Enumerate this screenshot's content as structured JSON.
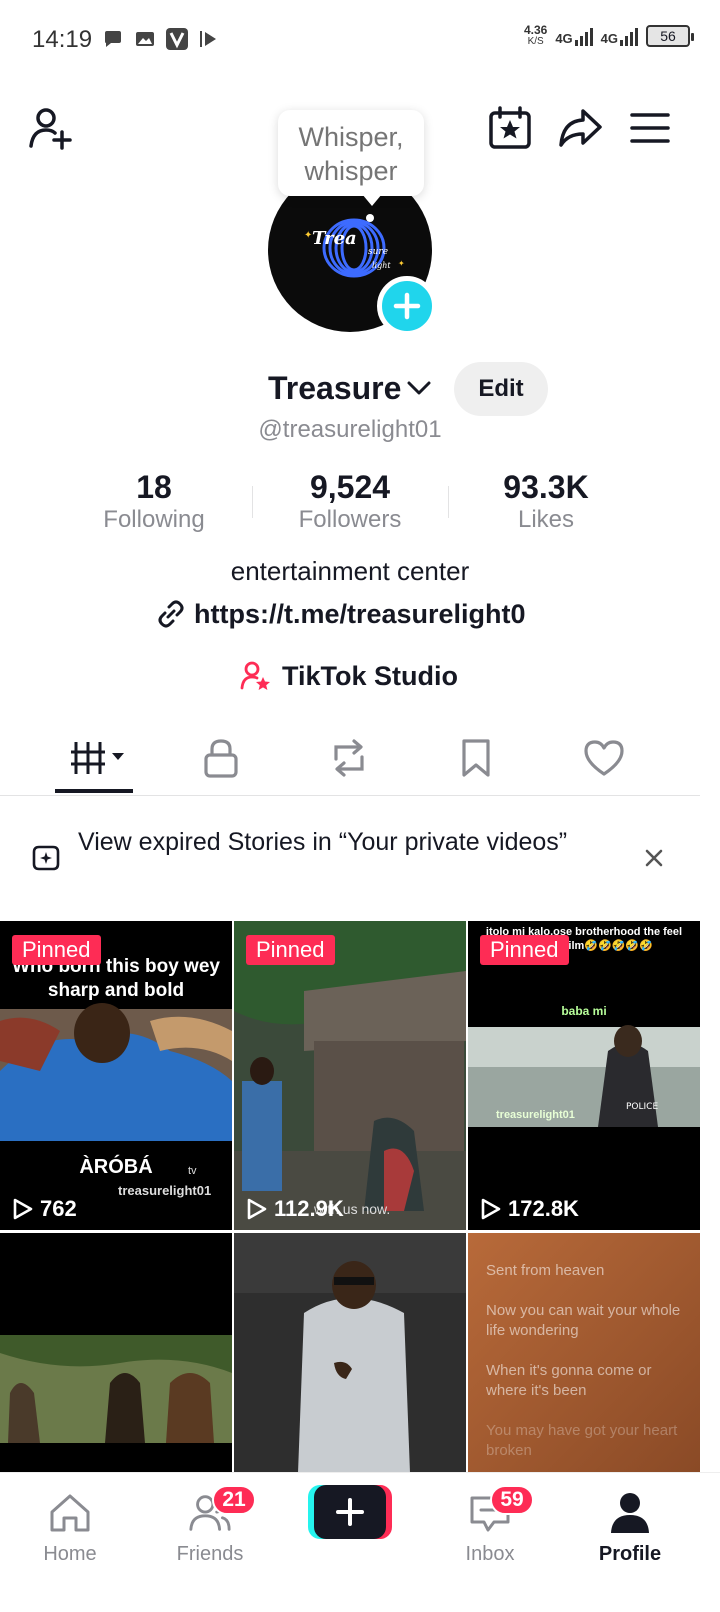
{
  "status_bar": {
    "time": "14:19",
    "speed_value": "4.36",
    "speed_unit": "K/S",
    "net1": "4G",
    "net2": "4G",
    "battery": "56"
  },
  "header": {
    "tooltip_line1": "Whisper,",
    "tooltip_line2": "whisper",
    "avatar_text": "Trea sure light"
  },
  "profile": {
    "name": "Treasure",
    "edit_label": "Edit",
    "handle": "@treasurelight01",
    "stats": [
      {
        "value": "18",
        "label": "Following"
      },
      {
        "value": "9,524",
        "label": "Followers"
      },
      {
        "value": "93.3K",
        "label": "Likes"
      }
    ],
    "bio": "entertainment center",
    "link": "https://t.me/treasurelight0",
    "studio_label": "TikTok Studio"
  },
  "banner": {
    "text": "View expired Stories in “Your private videos”"
  },
  "videos": [
    {
      "pinned_label": "Pinned",
      "views": "762",
      "caption_top": "Who born this boy wey sharp and bold",
      "caption_bottom": "ÀRÓBÁ",
      "watermark": "treasurelight01",
      "tv": "tv"
    },
    {
      "pinned_label": "Pinned",
      "views": "112.9K",
      "overlay": "with us now."
    },
    {
      "pinned_label": "Pinned",
      "views": "172.8K",
      "caption_top": "itolo mi kalo,ose brotherhood the feel your this film🤣🤣🤣🤣🤣",
      "caption_mid": "baba mi",
      "watermark": "treasurelight01",
      "police": "POLICE"
    },
    {},
    {},
    {
      "lyrics": [
        "Sent from heaven",
        "Now you can wait your whole life wondering",
        "When it's gonna come or where it's been",
        "You may have got your heart broken"
      ]
    }
  ],
  "nav": {
    "home": "Home",
    "friends": "Friends",
    "friends_badge": "21",
    "inbox": "Inbox",
    "inbox_badge": "59",
    "profile": "Profile"
  }
}
